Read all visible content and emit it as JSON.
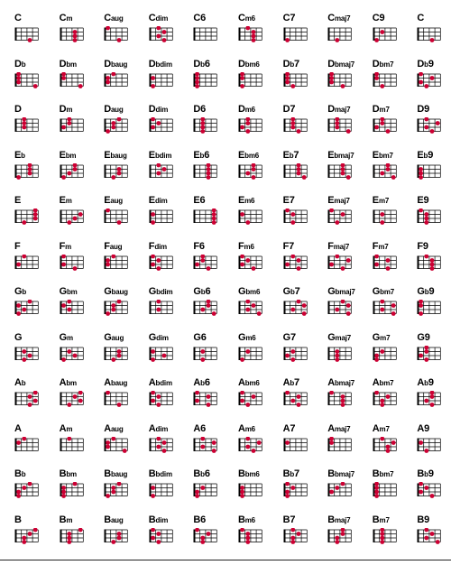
{
  "colors": {
    "dot": "#cc0033",
    "line": "#000000",
    "text": "#000000"
  },
  "rows": [
    [
      {
        "root": "C",
        "suffix": "",
        "frets": [
          0,
          0,
          0,
          3
        ]
      },
      {
        "root": "C",
        "suffix": "m",
        "frets": [
          0,
          3,
          3,
          3
        ]
      },
      {
        "root": "C",
        "suffix": "aug",
        "frets": [
          1,
          0,
          0,
          3
        ]
      },
      {
        "root": "C",
        "suffix": "dim",
        "frets": [
          2,
          3,
          2,
          3
        ]
      },
      {
        "root": "C",
        "suffix": "6",
        "frets": [
          0,
          0,
          0,
          0
        ]
      },
      {
        "root": "C",
        "suffix": "m6",
        "frets": [
          2,
          3,
          3,
          3
        ]
      },
      {
        "root": "C",
        "suffix": "7",
        "frets": [
          0,
          0,
          0,
          1
        ]
      },
      {
        "root": "C",
        "suffix": "maj7",
        "frets": [
          0,
          0,
          0,
          2
        ]
      },
      {
        "root": "C",
        "suffix": "9",
        "frets": [
          0,
          2,
          0,
          1
        ]
      },
      {
        "root": "C",
        "suffix": "",
        "frets": [
          0,
          0,
          0,
          3
        ]
      }
    ],
    [
      {
        "root": "D",
        "flat": "b",
        "suffix": "",
        "frets": [
          1,
          1,
          1,
          4
        ]
      },
      {
        "root": "D",
        "flat": "b",
        "suffix": "m",
        "frets": [
          1,
          1,
          0,
          4
        ]
      },
      {
        "root": "D",
        "flat": "b",
        "suffix": "aug",
        "frets": [
          2,
          1,
          1,
          0
        ]
      },
      {
        "root": "D",
        "flat": "b",
        "suffix": "dim",
        "frets": [
          0,
          1,
          0,
          1
        ]
      },
      {
        "root": "D",
        "flat": "b",
        "suffix": "6",
        "frets": [
          1,
          1,
          1,
          1
        ]
      },
      {
        "root": "D",
        "flat": "b",
        "suffix": "m6",
        "frets": [
          1,
          1,
          0,
          1
        ]
      },
      {
        "root": "D",
        "flat": "b",
        "suffix": "7",
        "frets": [
          1,
          1,
          1,
          2
        ]
      },
      {
        "root": "D",
        "flat": "b",
        "suffix": "maj7",
        "frets": [
          1,
          1,
          1,
          3
        ]
      },
      {
        "root": "D",
        "flat": "b",
        "suffix": "m7",
        "frets": [
          1,
          1,
          0,
          2
        ]
      },
      {
        "root": "D",
        "flat": "b",
        "suffix": "9",
        "frets": [
          1,
          3,
          1,
          2
        ]
      }
    ],
    [
      {
        "root": "D",
        "suffix": "",
        "frets": [
          2,
          2,
          2,
          0
        ]
      },
      {
        "root": "D",
        "suffix": "m",
        "frets": [
          2,
          2,
          1,
          0
        ]
      },
      {
        "root": "D",
        "suffix": "aug",
        "frets": [
          3,
          2,
          2,
          1
        ]
      },
      {
        "root": "D",
        "suffix": "dim",
        "frets": [
          1,
          2,
          1,
          0
        ]
      },
      {
        "root": "D",
        "suffix": "6",
        "frets": [
          2,
          2,
          2,
          2
        ]
      },
      {
        "root": "D",
        "suffix": "m6",
        "frets": [
          2,
          2,
          1,
          2
        ]
      },
      {
        "root": "D",
        "suffix": "7",
        "frets": [
          2,
          2,
          2,
          3
        ]
      },
      {
        "root": "D",
        "suffix": "maj7",
        "frets": [
          2,
          2,
          2,
          4
        ]
      },
      {
        "root": "D",
        "suffix": "m7",
        "frets": [
          2,
          2,
          1,
          3
        ]
      },
      {
        "root": "D",
        "suffix": "9",
        "frets": [
          2,
          4,
          2,
          3
        ]
      }
    ],
    [
      {
        "root": "E",
        "flat": "b",
        "suffix": "",
        "frets": [
          3,
          3,
          3,
          1
        ]
      },
      {
        "root": "E",
        "flat": "b",
        "suffix": "m",
        "frets": [
          3,
          3,
          2,
          1
        ]
      },
      {
        "root": "E",
        "flat": "b",
        "suffix": "aug",
        "frets": [
          0,
          3,
          3,
          2
        ]
      },
      {
        "root": "E",
        "flat": "b",
        "suffix": "dim",
        "frets": [
          2,
          3,
          2,
          0
        ]
      },
      {
        "root": "E",
        "flat": "b",
        "suffix": "6",
        "frets": [
          3,
          3,
          3,
          3
        ]
      },
      {
        "root": "E",
        "flat": "b",
        "suffix": "m6",
        "frets": [
          3,
          3,
          2,
          3
        ]
      },
      {
        "root": "E",
        "flat": "b",
        "suffix": "7",
        "frets": [
          3,
          3,
          3,
          4
        ]
      },
      {
        "root": "E",
        "flat": "b",
        "suffix": "maj7",
        "frets": [
          3,
          3,
          3,
          5
        ]
      },
      {
        "root": "E",
        "flat": "b",
        "suffix": "m7",
        "frets": [
          3,
          3,
          2,
          4
        ]
      },
      {
        "root": "E",
        "flat": "b",
        "suffix": "9",
        "frets": [
          0,
          1,
          1,
          1
        ]
      }
    ],
    [
      {
        "root": "E",
        "suffix": "",
        "frets": [
          4,
          4,
          4,
          2
        ]
      },
      {
        "root": "E",
        "suffix": "m",
        "frets": [
          0,
          4,
          3,
          2
        ]
      },
      {
        "root": "E",
        "suffix": "aug",
        "frets": [
          1,
          0,
          0,
          3
        ]
      },
      {
        "root": "E",
        "suffix": "dim",
        "frets": [
          0,
          1,
          0,
          1
        ]
      },
      {
        "root": "E",
        "suffix": "6",
        "frets": [
          4,
          4,
          4,
          4
        ]
      },
      {
        "root": "E",
        "suffix": "m6",
        "frets": [
          0,
          1,
          0,
          2
        ]
      },
      {
        "root": "E",
        "suffix": "7",
        "frets": [
          1,
          2,
          0,
          2
        ]
      },
      {
        "root": "E",
        "suffix": "maj7",
        "frets": [
          1,
          3,
          0,
          2
        ]
      },
      {
        "root": "E",
        "suffix": "m7",
        "frets": [
          0,
          2,
          0,
          2
        ]
      },
      {
        "root": "E",
        "suffix": "9",
        "frets": [
          1,
          2,
          2,
          2
        ]
      }
    ],
    [
      {
        "root": "F",
        "suffix": "",
        "frets": [
          2,
          0,
          1,
          0
        ]
      },
      {
        "root": "F",
        "suffix": "m",
        "frets": [
          1,
          0,
          1,
          3
        ]
      },
      {
        "root": "F",
        "suffix": "aug",
        "frets": [
          2,
          1,
          1,
          0
        ]
      },
      {
        "root": "F",
        "suffix": "dim",
        "frets": [
          1,
          2,
          1,
          2
        ]
      },
      {
        "root": "F",
        "suffix": "6",
        "frets": [
          2,
          2,
          1,
          3
        ]
      },
      {
        "root": "F",
        "suffix": "m6",
        "frets": [
          1,
          2,
          1,
          3
        ]
      },
      {
        "root": "F",
        "suffix": "7",
        "frets": [
          2,
          3,
          1,
          3
        ]
      },
      {
        "root": "F",
        "suffix": "maj7",
        "frets": [
          2,
          4,
          1,
          3
        ]
      },
      {
        "root": "F",
        "suffix": "m7",
        "frets": [
          1,
          3,
          1,
          3
        ]
      },
      {
        "root": "F",
        "suffix": "9",
        "frets": [
          2,
          3,
          3,
          3
        ]
      }
    ],
    [
      {
        "root": "G",
        "flat": "b",
        "suffix": "",
        "frets": [
          3,
          1,
          2,
          1
        ]
      },
      {
        "root": "G",
        "flat": "b",
        "suffix": "m",
        "frets": [
          2,
          1,
          2,
          0
        ]
      },
      {
        "root": "G",
        "flat": "b",
        "suffix": "aug",
        "frets": [
          3,
          2,
          2,
          1
        ]
      },
      {
        "root": "G",
        "flat": "b",
        "suffix": "dim",
        "frets": [
          2,
          0,
          2,
          0
        ]
      },
      {
        "root": "G",
        "flat": "b",
        "suffix": "6",
        "frets": [
          3,
          3,
          2,
          4
        ]
      },
      {
        "root": "G",
        "flat": "b",
        "suffix": "m6",
        "frets": [
          2,
          3,
          2,
          4
        ]
      },
      {
        "root": "G",
        "flat": "b",
        "suffix": "7",
        "frets": [
          3,
          4,
          2,
          4
        ]
      },
      {
        "root": "G",
        "flat": "b",
        "suffix": "maj7",
        "frets": [
          3,
          5,
          2,
          4
        ]
      },
      {
        "root": "G",
        "flat": "b",
        "suffix": "m7",
        "frets": [
          2,
          4,
          2,
          4
        ]
      },
      {
        "root": "G",
        "flat": "b",
        "suffix": "9",
        "frets": [
          1,
          1,
          0,
          1
        ]
      }
    ],
    [
      {
        "root": "G",
        "suffix": "",
        "frets": [
          0,
          2,
          3,
          2
        ]
      },
      {
        "root": "G",
        "suffix": "m",
        "frets": [
          0,
          2,
          3,
          1
        ]
      },
      {
        "root": "G",
        "suffix": "aug",
        "frets": [
          0,
          3,
          3,
          2
        ]
      },
      {
        "root": "G",
        "suffix": "dim",
        "frets": [
          0,
          1,
          3,
          1
        ]
      },
      {
        "root": "G",
        "suffix": "6",
        "frets": [
          0,
          2,
          0,
          2
        ]
      },
      {
        "root": "G",
        "suffix": "m6",
        "frets": [
          0,
          2,
          0,
          1
        ]
      },
      {
        "root": "G",
        "suffix": "7",
        "frets": [
          0,
          2,
          1,
          2
        ]
      },
      {
        "root": "G",
        "suffix": "maj7",
        "frets": [
          0,
          2,
          2,
          2
        ]
      },
      {
        "root": "G",
        "suffix": "m7",
        "frets": [
          0,
          2,
          1,
          1
        ]
      },
      {
        "root": "G",
        "suffix": "9",
        "frets": [
          2,
          2,
          1,
          2
        ]
      }
    ],
    [
      {
        "root": "A",
        "flat": "b",
        "suffix": "",
        "frets": [
          5,
          3,
          4,
          3
        ]
      },
      {
        "root": "A",
        "flat": "b",
        "suffix": "m",
        "frets": [
          4,
          3,
          4,
          2
        ]
      },
      {
        "root": "A",
        "flat": "b",
        "suffix": "aug",
        "frets": [
          1,
          0,
          0,
          3
        ]
      },
      {
        "root": "A",
        "flat": "b",
        "suffix": "dim",
        "frets": [
          1,
          2,
          1,
          2
        ]
      },
      {
        "root": "A",
        "flat": "b",
        "suffix": "6",
        "frets": [
          1,
          3,
          1,
          3
        ]
      },
      {
        "root": "A",
        "flat": "b",
        "suffix": "m6",
        "frets": [
          1,
          3,
          1,
          2
        ]
      },
      {
        "root": "A",
        "flat": "b",
        "suffix": "7",
        "frets": [
          1,
          3,
          2,
          3
        ]
      },
      {
        "root": "A",
        "flat": "b",
        "suffix": "maj7",
        "frets": [
          1,
          3,
          3,
          3
        ]
      },
      {
        "root": "A",
        "flat": "b",
        "suffix": "m7",
        "frets": [
          1,
          3,
          2,
          2
        ]
      },
      {
        "root": "A",
        "flat": "b",
        "suffix": "9",
        "frets": [
          3,
          3,
          2,
          3
        ]
      }
    ],
    [
      {
        "root": "A",
        "suffix": "",
        "frets": [
          2,
          1,
          0,
          0
        ]
      },
      {
        "root": "A",
        "suffix": "m",
        "frets": [
          2,
          0,
          0,
          0
        ]
      },
      {
        "root": "A",
        "suffix": "aug",
        "frets": [
          2,
          1,
          1,
          4
        ]
      },
      {
        "root": "A",
        "suffix": "dim",
        "frets": [
          2,
          3,
          2,
          3
        ]
      },
      {
        "root": "A",
        "suffix": "6",
        "frets": [
          2,
          4,
          2,
          4
        ]
      },
      {
        "root": "A",
        "suffix": "m6",
        "frets": [
          2,
          4,
          2,
          3
        ]
      },
      {
        "root": "A",
        "suffix": "7",
        "frets": [
          0,
          1,
          0,
          0
        ]
      },
      {
        "root": "A",
        "suffix": "maj7",
        "frets": [
          1,
          1,
          0,
          0
        ]
      },
      {
        "root": "A",
        "suffix": "m7",
        "frets": [
          2,
          4,
          3,
          3
        ]
      },
      {
        "root": "A",
        "suffix": "9",
        "frets": [
          0,
          1,
          0,
          2
        ]
      }
    ],
    [
      {
        "root": "B",
        "flat": "b",
        "suffix": "",
        "frets": [
          3,
          2,
          1,
          1
        ]
      },
      {
        "root": "B",
        "flat": "b",
        "suffix": "m",
        "frets": [
          3,
          1,
          1,
          1
        ]
      },
      {
        "root": "B",
        "flat": "b",
        "suffix": "aug",
        "frets": [
          3,
          2,
          2,
          1
        ]
      },
      {
        "root": "B",
        "flat": "b",
        "suffix": "dim",
        "frets": [
          0,
          1,
          0,
          1
        ]
      },
      {
        "root": "B",
        "flat": "b",
        "suffix": "6",
        "frets": [
          0,
          2,
          1,
          1
        ]
      },
      {
        "root": "B",
        "flat": "b",
        "suffix": "m6",
        "frets": [
          0,
          1,
          1,
          1
        ]
      },
      {
        "root": "B",
        "flat": "b",
        "suffix": "7",
        "frets": [
          1,
          2,
          1,
          1
        ]
      },
      {
        "root": "B",
        "flat": "b",
        "suffix": "maj7",
        "frets": [
          3,
          2,
          1,
          0
        ]
      },
      {
        "root": "B",
        "flat": "b",
        "suffix": "m7",
        "frets": [
          1,
          1,
          1,
          1
        ]
      },
      {
        "root": "B",
        "flat": "b",
        "suffix": "9",
        "frets": [
          1,
          2,
          1,
          3
        ]
      }
    ],
    [
      {
        "root": "B",
        "suffix": "",
        "frets": [
          4,
          3,
          2,
          2
        ]
      },
      {
        "root": "B",
        "suffix": "m",
        "frets": [
          4,
          2,
          2,
          2
        ]
      },
      {
        "root": "B",
        "suffix": "aug",
        "frets": [
          0,
          3,
          3,
          2
        ]
      },
      {
        "root": "B",
        "suffix": "dim",
        "frets": [
          1,
          2,
          1,
          2
        ]
      },
      {
        "root": "B",
        "suffix": "6",
        "frets": [
          1,
          3,
          2,
          2
        ]
      },
      {
        "root": "B",
        "suffix": "m6",
        "frets": [
          1,
          2,
          2,
          2
        ]
      },
      {
        "root": "B",
        "suffix": "7",
        "frets": [
          2,
          3,
          2,
          2
        ]
      },
      {
        "root": "B",
        "suffix": "maj7",
        "frets": [
          3,
          3,
          2,
          2
        ]
      },
      {
        "root": "B",
        "suffix": "m7",
        "frets": [
          2,
          2,
          2,
          2
        ]
      },
      {
        "root": "B",
        "suffix": "9",
        "frets": [
          2,
          3,
          2,
          4
        ]
      }
    ]
  ]
}
